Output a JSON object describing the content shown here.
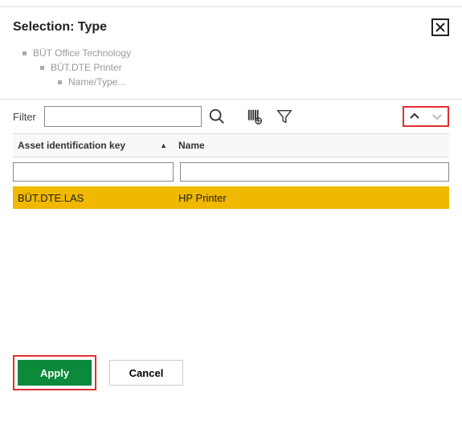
{
  "header": {
    "title": "Selection: Type"
  },
  "tree": {
    "lvl1": "BÜT Office Technology",
    "lvl2": "BÜT.DTE Printer",
    "lvl3": "Name/Type..."
  },
  "filter": {
    "label": "Filter",
    "value": ""
  },
  "columns": {
    "key": "Asset identification key",
    "name": "Name"
  },
  "column_filters": {
    "key": "",
    "name": ""
  },
  "rows": [
    {
      "key": "BÜT.DTE.LAS",
      "name": "HP Printer",
      "selected": true
    }
  ],
  "buttons": {
    "apply": "Apply",
    "cancel": "Cancel"
  }
}
